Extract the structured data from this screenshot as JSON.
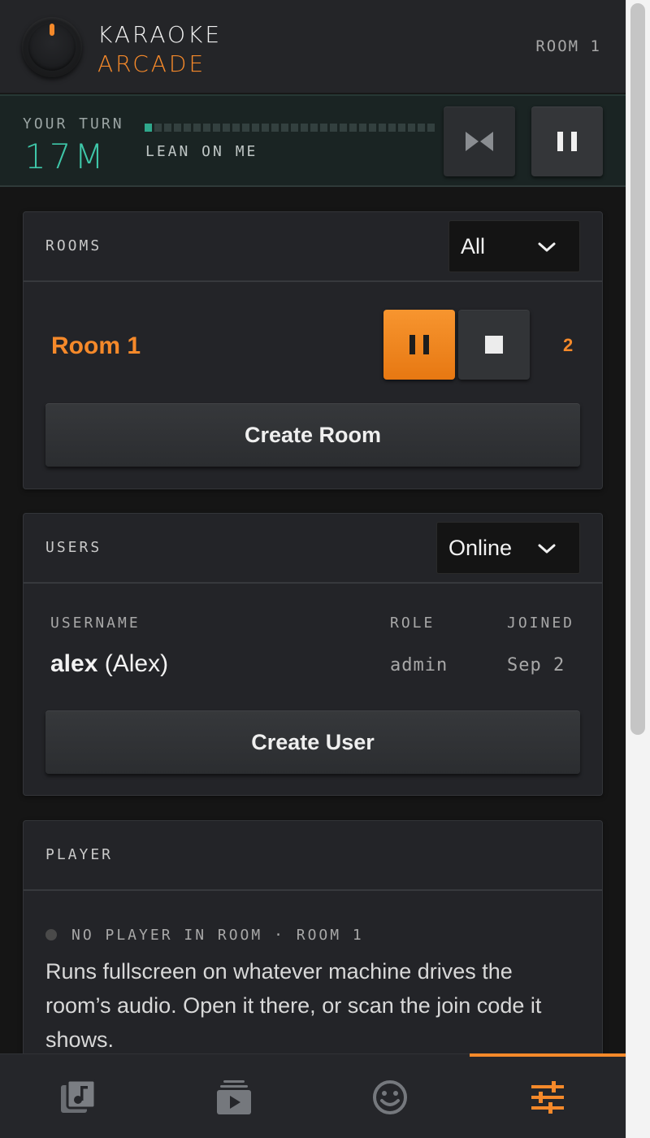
{
  "header": {
    "brand_line1": "KARAOKE",
    "brand_line2": "ARCADE",
    "room": "ROOM 1"
  },
  "now_playing": {
    "label": "YOUR TURN",
    "time": "17M",
    "song": "LEAN ON ME",
    "progress_segments_total": 30,
    "progress_segments_lit": 1
  },
  "rooms_card": {
    "title": "ROOMS",
    "filter_value": "All",
    "room_name": "Room 1",
    "room_count": "2",
    "create_label": "Create Room"
  },
  "users_card": {
    "title": "USERS",
    "filter_value": "Online",
    "columns": [
      "USERNAME",
      "ROLE",
      "JOINED"
    ],
    "rows": [
      {
        "username": "alex",
        "display_name": "(Alex)",
        "role": "admin",
        "joined": "Sep 2"
      }
    ],
    "create_label": "Create User"
  },
  "player_card": {
    "title": "PLAYER",
    "status": "NO PLAYER IN ROOM · ROOM 1",
    "description": "Runs fullscreen on whatever machine drives the room’s audio. Open it there, or scan the join code it shows."
  },
  "bottom_nav": {
    "items": [
      {
        "icon": "music-library-icon",
        "active": false
      },
      {
        "icon": "queue-play-icon",
        "active": false
      },
      {
        "icon": "smiley-icon",
        "active": false
      },
      {
        "icon": "sliders-icon",
        "active": true
      }
    ]
  },
  "colors": {
    "accent": "#f5892a",
    "teal": "#3ec6a8",
    "background": "#151515",
    "card": "#232428"
  }
}
